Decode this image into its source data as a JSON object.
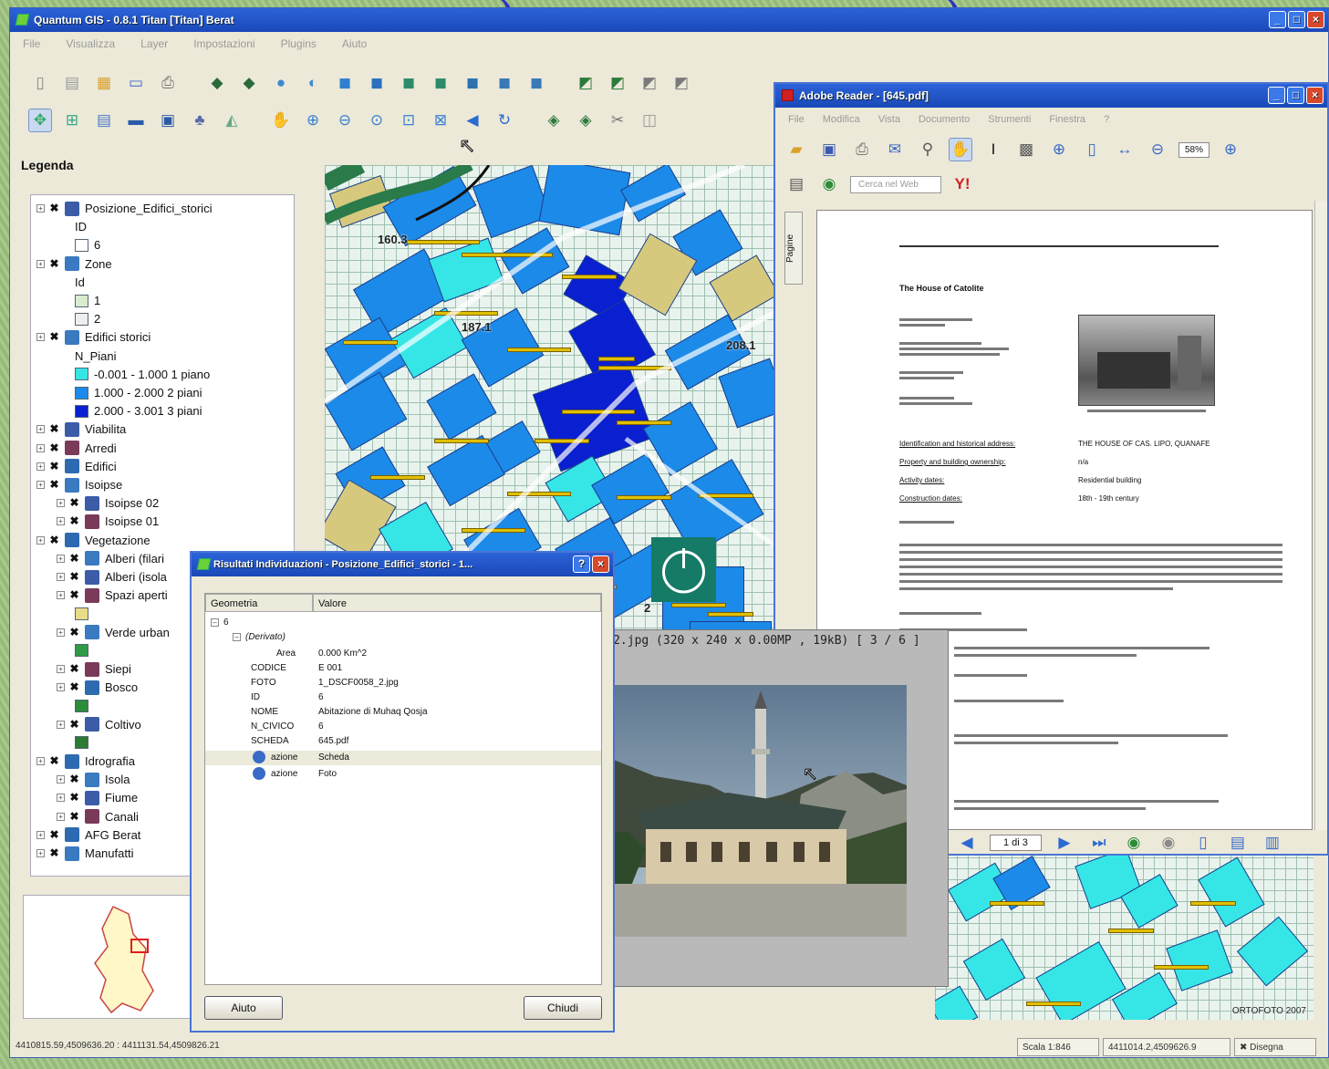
{
  "qgis": {
    "title": "Quantum GIS - 0.8.1 Titan [Titan] Berat",
    "menu": [
      "File",
      "Visualizza",
      "Layer",
      "Impostazioni",
      "Plugins",
      "Aiuto"
    ],
    "legend_title": "Legenda",
    "legend": [
      {
        "label": "Posizione_Edifici_storici",
        "type": "layer",
        "x": 6
      },
      {
        "label": "ID",
        "type": "text",
        "x": 48
      },
      {
        "label": "6",
        "type": "swatch",
        "x": 48,
        "color": "#ffffff"
      },
      {
        "label": "Zone",
        "type": "layer",
        "x": 6
      },
      {
        "label": "Id",
        "type": "text",
        "x": 48
      },
      {
        "label": "1",
        "type": "swatch",
        "x": 48,
        "color": "#d9ecd0"
      },
      {
        "label": "2",
        "type": "swatch",
        "x": 48,
        "color": "#eeeeee"
      },
      {
        "label": "Edifici storici",
        "type": "layer",
        "x": 6
      },
      {
        "label": "N_Piani",
        "type": "text",
        "x": 48
      },
      {
        "label": "-0.001 - 1.000 1 piano",
        "type": "swatch",
        "x": 48,
        "color": "#36e6e6"
      },
      {
        "label": "1.000 - 2.000 2 piani",
        "type": "swatch",
        "x": 48,
        "color": "#1c8ae8"
      },
      {
        "label": "2.000 - 3.001 3 piani",
        "type": "swatch",
        "x": 48,
        "color": "#0a1fd0"
      },
      {
        "label": "Viabilita",
        "type": "layer",
        "x": 6
      },
      {
        "label": "Arredi",
        "type": "layer",
        "x": 6
      },
      {
        "label": "Edifici",
        "type": "layer",
        "x": 6
      },
      {
        "label": "Isoipse",
        "type": "layer",
        "x": 6
      },
      {
        "label": "Isoipse 02",
        "type": "layer",
        "x": 28
      },
      {
        "label": "Isoipse 01",
        "type": "layer",
        "x": 28
      },
      {
        "label": "Vegetazione",
        "type": "layer",
        "x": 6
      },
      {
        "label": "Alberi (filari",
        "type": "layer",
        "x": 28
      },
      {
        "label": "Alberi (isola",
        "type": "layer",
        "x": 28
      },
      {
        "label": "Spazi aperti",
        "type": "layer",
        "x": 28
      },
      {
        "label": "",
        "type": "swatch",
        "x": 48,
        "color": "#e8dc86"
      },
      {
        "label": "Verde urban",
        "type": "layer",
        "x": 28
      },
      {
        "label": "",
        "type": "swatch",
        "x": 48,
        "color": "#2f9b46"
      },
      {
        "label": "Siepi",
        "type": "layer",
        "x": 28
      },
      {
        "label": "Bosco",
        "type": "layer",
        "x": 28
      },
      {
        "label": "",
        "type": "swatch",
        "x": 48,
        "color": "#2c8c3a"
      },
      {
        "label": "Coltivo",
        "type": "layer",
        "x": 28
      },
      {
        "label": "",
        "type": "swatch",
        "x": 48,
        "color": "#2c7a33"
      },
      {
        "label": "Idrografia",
        "type": "layer",
        "x": 6
      },
      {
        "label": "Isola",
        "type": "layer",
        "x": 28
      },
      {
        "label": "Fiume",
        "type": "layer",
        "x": 28
      },
      {
        "label": "Canali",
        "type": "layer",
        "x": 28
      },
      {
        "label": "AFG Berat",
        "type": "layer",
        "x": 6
      },
      {
        "label": "Manufatti",
        "type": "layer",
        "x": 6
      }
    ],
    "map_labels": [
      "160.3",
      "187.1",
      "208.1",
      "2"
    ],
    "map2_label": "ORTOFOTO 2007",
    "status": {
      "coords_left": "4410815.59,4509636.20 : 4411131.54,4509826.21",
      "scale": "Scala 1:846",
      "coords_right": "4411014.2,4509626.9",
      "render_label": "Disegna"
    }
  },
  "reader": {
    "title": "Adobe Reader - [645.pdf]",
    "menu": [
      "File",
      "Modifica",
      "Vista",
      "Documento",
      "Strumenti",
      "Finestra",
      "?"
    ],
    "zoom": "58%",
    "search_placeholder": "Cerca nel Web",
    "side_tab": "Pagine",
    "page_counter": "1 di 3",
    "doc_heading": "The House of Catolite",
    "pdf_table": [
      {
        "key": "Identification and historical address:",
        "value": "THE HOUSE OF CAS. LIPO, QUANAFE"
      },
      {
        "key": "Property and building ownership:",
        "value": "n/a"
      },
      {
        "key": "Activity dates:",
        "value": "Residential building"
      },
      {
        "key": "Construction dates:",
        "value": "18th - 19th century"
      }
    ]
  },
  "photo": {
    "caption": "4_DSCF0169_2.jpg  (320 x 240 x 0.00MP  ,  19kB)  [ 3 / 6 ]"
  },
  "results": {
    "title": "Risultati Individuazioni - Posizione_Edifici_storici - 1...",
    "columns": [
      "Geometria",
      "Valore"
    ],
    "root": "6",
    "group": "(Derivato)",
    "attributes": [
      {
        "key": "Area",
        "value": "0.000 Km^2"
      },
      {
        "key": "CODICE",
        "value": "E 001"
      },
      {
        "key": "FOTO",
        "value": "1_DSCF0058_2.jpg"
      },
      {
        "key": "ID",
        "value": "6"
      },
      {
        "key": "NOME",
        "value": "Abitazione di Muhaq Qosja"
      },
      {
        "key": "N_CIVICO",
        "value": "6"
      },
      {
        "key": "SCHEDA",
        "value": "645.pdf"
      }
    ],
    "actions": [
      {
        "key": "azione",
        "value": "Scheda"
      },
      {
        "key": "azione",
        "value": "Foto"
      }
    ],
    "help_label": "Aiuto",
    "close_label": "Chiudi"
  },
  "colors": {
    "blue": "#1c8ae8",
    "light": "#36e6e6",
    "dark": "#0a1fd0",
    "tan": "#d6c97e",
    "title": "#2b63d8",
    "power": "#157a66"
  }
}
